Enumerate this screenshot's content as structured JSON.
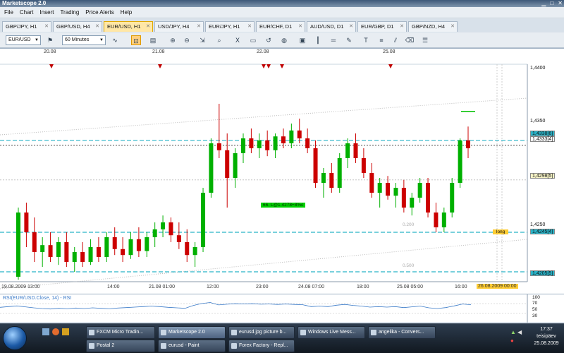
{
  "app": {
    "title": "Marketscope 2.0"
  },
  "menu": [
    "File",
    "Chart",
    "Insert",
    "Trading",
    "Price Alerts",
    "Help"
  ],
  "tabs": [
    {
      "label": "GBP/JPY, H1",
      "active": false
    },
    {
      "label": "GBP/USD, H4",
      "active": false
    },
    {
      "label": "EUR/USD, H1",
      "active": true
    },
    {
      "label": "USD/JPY, H4",
      "active": false
    },
    {
      "label": "EUR/JPY, H1",
      "active": false
    },
    {
      "label": "EUR/CHF, D1",
      "active": false
    },
    {
      "label": "AUD/USD, D1",
      "active": false
    },
    {
      "label": "EUR/GBP, D1",
      "active": false
    },
    {
      "label": "GBP/NZD, H4",
      "active": false
    }
  ],
  "toolbar": {
    "symbol": "EUR/USD",
    "timeframe": "60 Minutes"
  },
  "chart": {
    "top_dates": [
      "20.08",
      "21.08",
      "22.08",
      "25.08"
    ],
    "bottom_times": [
      "19.08.2009 13:00",
      "14:00",
      "21.08 01:00",
      "12:00",
      "23:00",
      "24.08 07:00",
      "18:00",
      "25.08 05:00",
      "16:00"
    ],
    "cursor_time": "26.08.2009 00:00",
    "price_ticks": [
      "1,4400",
      "1,4350",
      "1,4250"
    ],
    "price_markers": [
      {
        "label": "1,4338[6]",
        "price": 1.4338,
        "color": "#29b3c8"
      },
      {
        "label": "1,4333[4]",
        "price": 1.4333,
        "color": "#ffffff"
      },
      {
        "label": "1,4298[5]",
        "price": 1.4298,
        "color": "#f6f3c6"
      },
      {
        "label": "1,4245[4]",
        "price": 1.4245,
        "color": "#29b3c8"
      },
      {
        "label": "1,4205[5]",
        "price": 1.4205,
        "color": "#29b3c8"
      }
    ],
    "annotations": {
      "trade": "66. L@1.4278+8%c",
      "long": "long",
      "fib_200": "0.200",
      "fib_500": "0.500"
    }
  },
  "chart_data": {
    "type": "candlestick",
    "symbol": "EUR/USD",
    "timeframe": "H1",
    "ylim": [
      1.4195,
      1.4415
    ],
    "candles": [
      [
        1.42,
        1.427,
        1.4197,
        1.4265
      ],
      [
        1.4265,
        1.4275,
        1.423,
        1.4245
      ],
      [
        1.4245,
        1.426,
        1.4215,
        1.4225
      ],
      [
        1.4225,
        1.424,
        1.421,
        1.4232
      ],
      [
        1.4232,
        1.4245,
        1.4215,
        1.422
      ],
      [
        1.422,
        1.424,
        1.4212,
        1.4235
      ],
      [
        1.4235,
        1.4245,
        1.421,
        1.4215
      ],
      [
        1.4215,
        1.423,
        1.4205,
        1.4225
      ],
      [
        1.4225,
        1.4235,
        1.421,
        1.4215
      ],
      [
        1.4215,
        1.4238,
        1.4212,
        1.423
      ],
      [
        1.423,
        1.424,
        1.4215,
        1.422
      ],
      [
        1.422,
        1.4245,
        1.4215,
        1.424
      ],
      [
        1.424,
        1.425,
        1.4222,
        1.4228
      ],
      [
        1.4228,
        1.424,
        1.4215,
        1.4222
      ],
      [
        1.4222,
        1.4245,
        1.4218,
        1.4238
      ],
      [
        1.4238,
        1.425,
        1.422,
        1.4226
      ],
      [
        1.4226,
        1.4245,
        1.422,
        1.424
      ],
      [
        1.424,
        1.4255,
        1.423,
        1.4248
      ],
      [
        1.4248,
        1.4262,
        1.424,
        1.4255
      ],
      [
        1.4255,
        1.426,
        1.4235,
        1.4242
      ],
      [
        1.4242,
        1.4255,
        1.4228,
        1.4235
      ],
      [
        1.4235,
        1.4248,
        1.4215,
        1.4222
      ],
      [
        1.4222,
        1.4235,
        1.421,
        1.423
      ],
      [
        1.423,
        1.429,
        1.4225,
        1.4285
      ],
      [
        1.4285,
        1.434,
        1.428,
        1.4335
      ],
      [
        1.4335,
        1.4375,
        1.432,
        1.4328
      ],
      [
        1.4328,
        1.4345,
        1.427,
        1.43
      ],
      [
        1.43,
        1.433,
        1.429,
        1.4325
      ],
      [
        1.4325,
        1.4345,
        1.4315,
        1.434
      ],
      [
        1.434,
        1.435,
        1.4325,
        1.433
      ],
      [
        1.433,
        1.4345,
        1.432,
        1.4338
      ],
      [
        1.4338,
        1.4348,
        1.4322,
        1.4328
      ],
      [
        1.4328,
        1.4345,
        1.432,
        1.4342
      ],
      [
        1.4342,
        1.435,
        1.433,
        1.4335
      ],
      [
        1.4335,
        1.4355,
        1.433,
        1.4348
      ],
      [
        1.4348,
        1.436,
        1.4335,
        1.434
      ],
      [
        1.434,
        1.435,
        1.4325,
        1.433
      ],
      [
        1.433,
        1.4338,
        1.429,
        1.4295
      ],
      [
        1.4295,
        1.431,
        1.428,
        1.4305
      ],
      [
        1.4305,
        1.4315,
        1.4285,
        1.429
      ],
      [
        1.429,
        1.4325,
        1.4285,
        1.432
      ],
      [
        1.432,
        1.434,
        1.431,
        1.4335
      ],
      [
        1.4335,
        1.4345,
        1.4315,
        1.432
      ],
      [
        1.432,
        1.433,
        1.43,
        1.4305
      ],
      [
        1.4305,
        1.4315,
        1.428,
        1.4285
      ],
      [
        1.4285,
        1.43,
        1.427,
        1.4295
      ],
      [
        1.4295,
        1.4302,
        1.4278,
        1.4282
      ],
      [
        1.4282,
        1.4295,
        1.427,
        1.429
      ],
      [
        1.429,
        1.4298,
        1.4265,
        1.427
      ],
      [
        1.427,
        1.4285,
        1.4262,
        1.428
      ],
      [
        1.428,
        1.43,
        1.4275,
        1.4295
      ],
      [
        1.4295,
        1.43,
        1.426,
        1.4265
      ],
      [
        1.4265,
        1.4275,
        1.4245,
        1.425
      ],
      [
        1.425,
        1.427,
        1.4245,
        1.4265
      ],
      [
        1.4265,
        1.43,
        1.426,
        1.4295
      ],
      [
        1.4295,
        1.434,
        1.429,
        1.4338
      ],
      [
        1.4338,
        1.4352,
        1.432,
        1.433
      ]
    ]
  },
  "rsi": {
    "label": "RSI(EUR/USD.Close, 14) - RSI",
    "levels": [
      "100",
      "70",
      "50",
      "30"
    ],
    "values": [
      52,
      55,
      58,
      54,
      50,
      47,
      45,
      48,
      46,
      49,
      47,
      50,
      48,
      46,
      49,
      51,
      53,
      55,
      57,
      55,
      52,
      50,
      48,
      60,
      68,
      72,
      62,
      65,
      67,
      66,
      67,
      65,
      66,
      64,
      66,
      64,
      63,
      55,
      57,
      55,
      61,
      64,
      60,
      57,
      53,
      55,
      53,
      55,
      51,
      54,
      57,
      50,
      47,
      51,
      58,
      66,
      63
    ]
  },
  "taskbar": {
    "row1": [
      "FXCM Micro Tradin...",
      "Marketscope 2.0",
      "eurusd.jpg picture b...",
      "Windows Live Mess...",
      "angelika - Convers..."
    ],
    "row2": [
      "Postal 2",
      "eurusd - Paint",
      "Forex Factory - Repl..."
    ],
    "clock_time": "17:37",
    "clock_day": "teisipäev",
    "clock_date": "25.08.2009"
  }
}
